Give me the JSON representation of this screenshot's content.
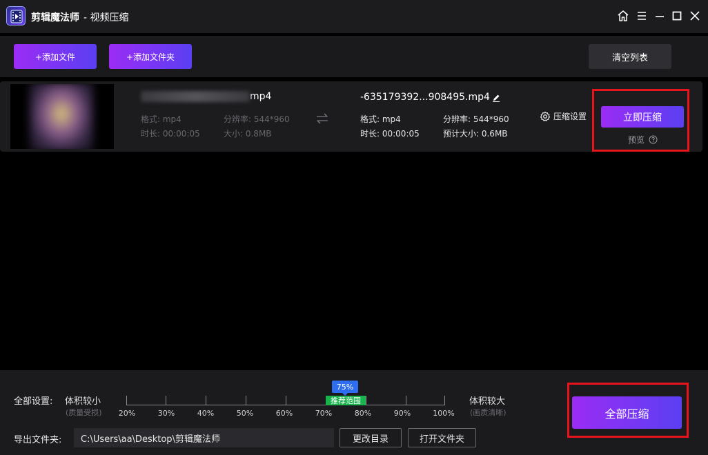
{
  "titlebar": {
    "app_name": "剪辑魔法师",
    "subtitle": "- 视频压缩",
    "icons": [
      "home-icon",
      "menu-icon",
      "minimize-icon",
      "maximize-icon",
      "close-icon"
    ]
  },
  "toolbar": {
    "add_file": "+添加文件",
    "add_folder": "+添加文件夹",
    "clear_list": "清空列表"
  },
  "file": {
    "source": {
      "name_suffix": "mp4",
      "format": "格式: mp4",
      "resolution": "分辨率: 544*960",
      "duration": "时长: 00:00:05",
      "size": "大小: 0.8MB"
    },
    "output": {
      "name": "-635179392...908495.mp4",
      "format": "格式: mp4",
      "resolution": "分辨率: 544*960",
      "duration": "时长: 00:00:05",
      "est_size": "预计大小: 0.6MB"
    },
    "settings_label": "压缩设置",
    "compress_now": "立即压缩",
    "preview": "预览"
  },
  "global": {
    "settings_label": "全部设置:",
    "small_label": "体积较小",
    "small_hint": "(质量受损)",
    "large_label": "体积较大",
    "large_hint": "(画质清晰)",
    "slider": {
      "value": "75%",
      "value_num": 75,
      "recommended": "推荐范围",
      "ticks": [
        "20%",
        "30%",
        "40%",
        "50%",
        "60%",
        "70%",
        "80%",
        "90%",
        "100%"
      ]
    },
    "export_label": "导出文件夹:",
    "export_path": "C:\\Users\\aa\\Desktop\\剪辑魔法师",
    "change_dir": "更改目录",
    "open_folder": "打开文件夹",
    "compress_all": "全部压缩"
  },
  "colors": {
    "accent_start": "#9b2cf5",
    "accent_end": "#5b3ff2",
    "highlight_red": "#e8141c",
    "recommend_green": "#18b34c",
    "bubble_blue": "#2f6df0"
  }
}
